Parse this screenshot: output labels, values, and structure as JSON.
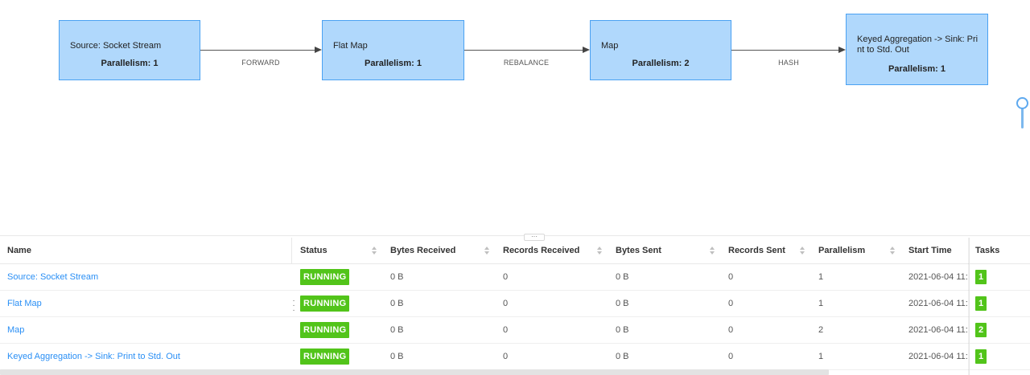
{
  "graph": {
    "nodes": [
      {
        "id": "n1",
        "name": "Source: Socket Stream",
        "parallelism": "Parallelism: 1"
      },
      {
        "id": "n2",
        "name": "Flat Map",
        "parallelism": "Parallelism: 1"
      },
      {
        "id": "n3",
        "name": "Map",
        "parallelism": "Parallelism: 2"
      },
      {
        "id": "n4",
        "name": "Keyed Aggregation -> Sink: Print to Std. Out",
        "parallelism": "Parallelism: 1"
      }
    ],
    "edges": [
      {
        "label": "FORWARD"
      },
      {
        "label": "REBALANCE"
      },
      {
        "label": "HASH"
      }
    ],
    "resize_glyph": "···"
  },
  "table": {
    "columns": [
      "Name",
      "Status",
      "Bytes Received",
      "Records Received",
      "Bytes Sent",
      "Records Sent",
      "Parallelism",
      "Start Time",
      "Tasks"
    ],
    "rows": [
      {
        "name": "Source: Socket Stream",
        "status": "RUNNING",
        "bytes_received": "0 B",
        "records_received": "0",
        "bytes_sent": "0 B",
        "records_sent": "0",
        "parallelism": "1",
        "start_time": "2021-06-04 11:",
        "tasks": "1"
      },
      {
        "name": "Flat Map",
        "status": "RUNNING",
        "bytes_received": "0 B",
        "records_received": "0",
        "bytes_sent": "0 B",
        "records_sent": "0",
        "parallelism": "1",
        "start_time": "2021-06-04 11:",
        "tasks": "1"
      },
      {
        "name": "Map",
        "status": "RUNNING",
        "bytes_received": "0 B",
        "records_received": "0",
        "bytes_sent": "0 B",
        "records_sent": "0",
        "parallelism": "2",
        "start_time": "2021-06-04 11:",
        "tasks": "2"
      },
      {
        "name": "Keyed Aggregation -> Sink: Print to Std. Out",
        "status": "RUNNING",
        "bytes_received": "0 B",
        "records_received": "0",
        "bytes_sent": "0 B",
        "records_sent": "0",
        "parallelism": "1",
        "start_time": "2021-06-04 11:",
        "tasks": "1"
      }
    ]
  },
  "colors": {
    "node_fill": "#b0d8fc",
    "node_border": "#4aa1f2",
    "link": "#2a8ff5",
    "running": "#52c41a"
  }
}
